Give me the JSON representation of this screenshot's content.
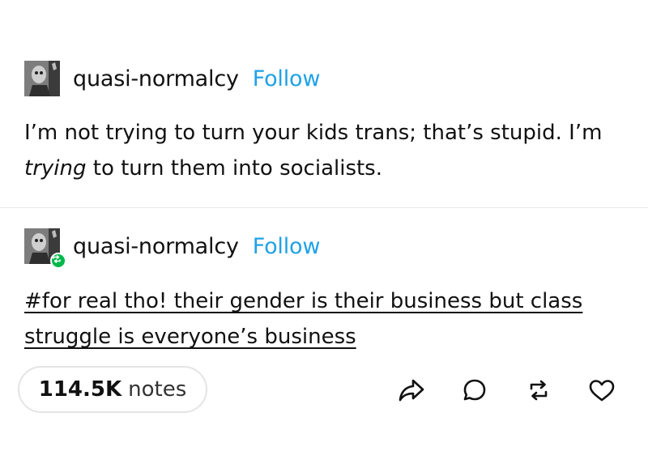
{
  "post": {
    "username": "quasi-normalcy",
    "follow_label": "Follow",
    "text_part1": "I’m not trying to turn your kids trans; that’s stupid. I’m ",
    "text_emphasis": "trying",
    "text_part2": " to turn them into socialists."
  },
  "reblog": {
    "username": "quasi-normalcy",
    "follow_label": "Follow",
    "tags_text": "#for real tho! their gender is their business but class struggle is everyone’s business"
  },
  "footer": {
    "notes_count": "114.5K",
    "notes_label": "notes",
    "actions": [
      {
        "icon": "share-icon"
      },
      {
        "icon": "reply-icon"
      },
      {
        "icon": "reblog-icon"
      },
      {
        "icon": "like-icon"
      }
    ]
  },
  "colors": {
    "follow": "#1fa2e6",
    "reblog_badge": "#00b84b",
    "divider": "#e9e9e9"
  }
}
